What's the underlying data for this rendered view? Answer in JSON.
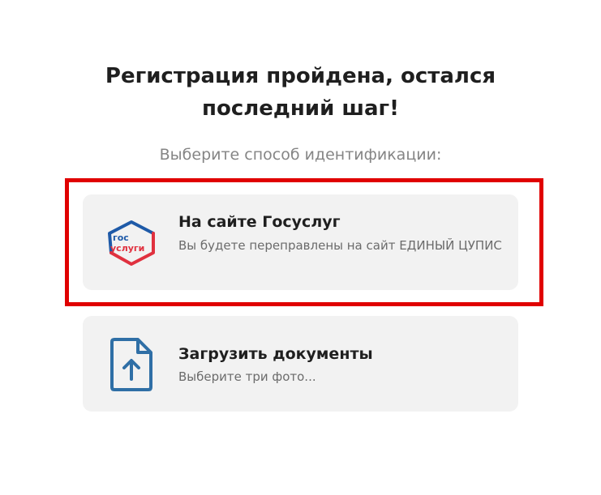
{
  "heading": {
    "line1": "Регистрация пройдена, остался",
    "line2": "последний шаг!"
  },
  "subtitle": "Выберите способ идентификации:",
  "options": [
    {
      "title": "На сайте Госуслуг",
      "description": "Вы будете переправлены на сайт ЕДИНЫЙ ЦУПИС",
      "icon": "gosuslugi-logo",
      "logo_text": [
        "гос",
        "услуги"
      ],
      "highlighted": true
    },
    {
      "title": "Загрузить документы",
      "description": "Выберите три фото...",
      "icon": "upload-document-icon",
      "highlighted": false
    }
  ],
  "colors": {
    "highlight_border": "#e00000",
    "card_background": "#f2f2f2",
    "gosuslugi_blue": "#1e5aa8",
    "gosuslugi_red": "#e0313f",
    "upload_icon": "#2f6fa6"
  }
}
